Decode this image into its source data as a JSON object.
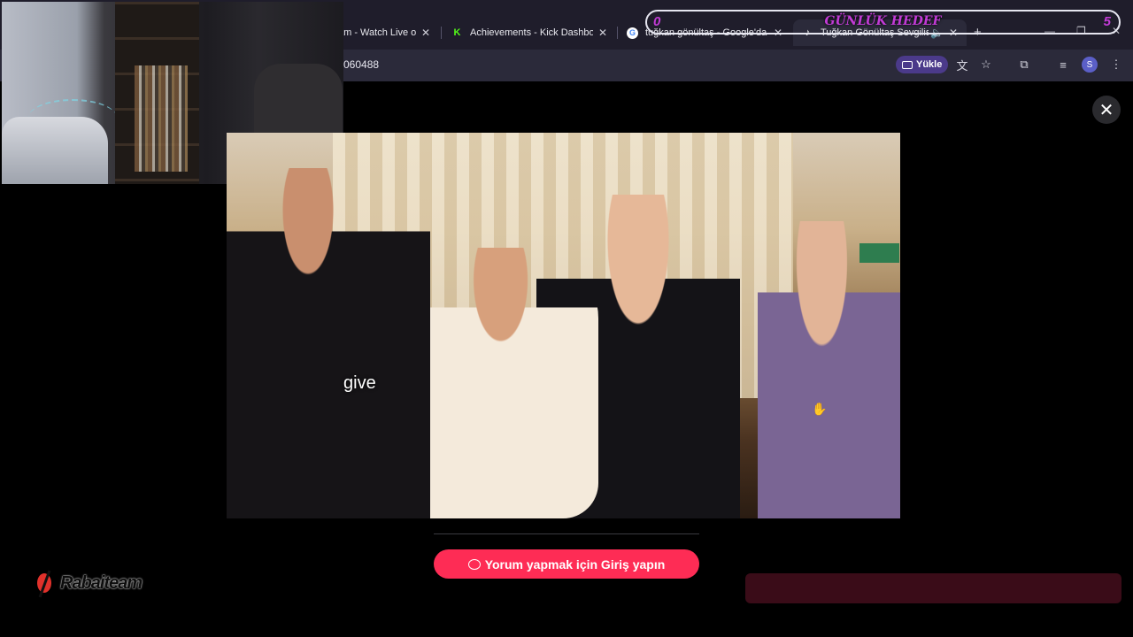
{
  "browser": {
    "tabs": [
      {
        "title": "am - Watch Live o",
        "favicon": "kick-icon",
        "active": false
      },
      {
        "title": "Achievements - Kick Dashboard",
        "favicon": "K",
        "active": false
      },
      {
        "title": "tuğkan gönültaş - Google'da Ar",
        "favicon": "G",
        "active": false
      },
      {
        "title": "Tuğkan Gönültaş Sevgilisi K",
        "favicon": "♪",
        "active": true
      }
    ],
    "url": "060488",
    "install_button": "Yükle",
    "profile_initial": "S"
  },
  "stream_overlay": {
    "goal_label": "GÜNLÜK HEDEF",
    "goal_current": "0",
    "goal_target": "5",
    "logo_text": "Rabaiteam"
  },
  "video": {
    "caption": "give"
  },
  "comments": {
    "login_button": "Yorum yapmak için Giriş yapın"
  },
  "colors": {
    "accent": "#fe2c55",
    "goal_text": "#c23bd6",
    "tab_bar": "#1f1d2b"
  }
}
